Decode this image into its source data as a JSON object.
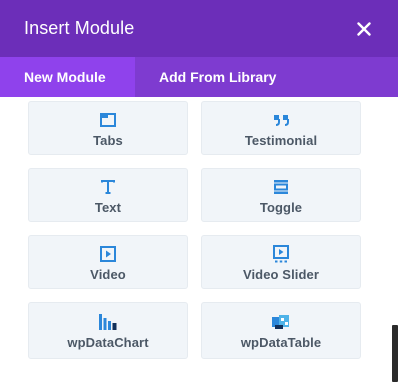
{
  "modal": {
    "title": "Insert Module",
    "close_icon": "close-icon"
  },
  "tabs": [
    {
      "label": "New Module",
      "active": true
    },
    {
      "label": "Add From Library",
      "active": false
    }
  ],
  "modules": [
    {
      "label": "Tabs",
      "icon": "tabs-icon"
    },
    {
      "label": "Testimonial",
      "icon": "quote-icon"
    },
    {
      "label": "Text",
      "icon": "text-icon"
    },
    {
      "label": "Toggle",
      "icon": "toggle-icon"
    },
    {
      "label": "Video",
      "icon": "video-icon"
    },
    {
      "label": "Video Slider",
      "icon": "video-slider-icon"
    },
    {
      "label": "wpDataChart",
      "icon": "bar-chart-icon"
    },
    {
      "label": "wpDataTable",
      "icon": "table-icon"
    }
  ],
  "colors": {
    "header": "#6c2eb9",
    "tab_bar": "#7e3bd0",
    "tab_active": "#8f42ec",
    "icon_blue": "#2b87da",
    "label": "#4c5866"
  }
}
